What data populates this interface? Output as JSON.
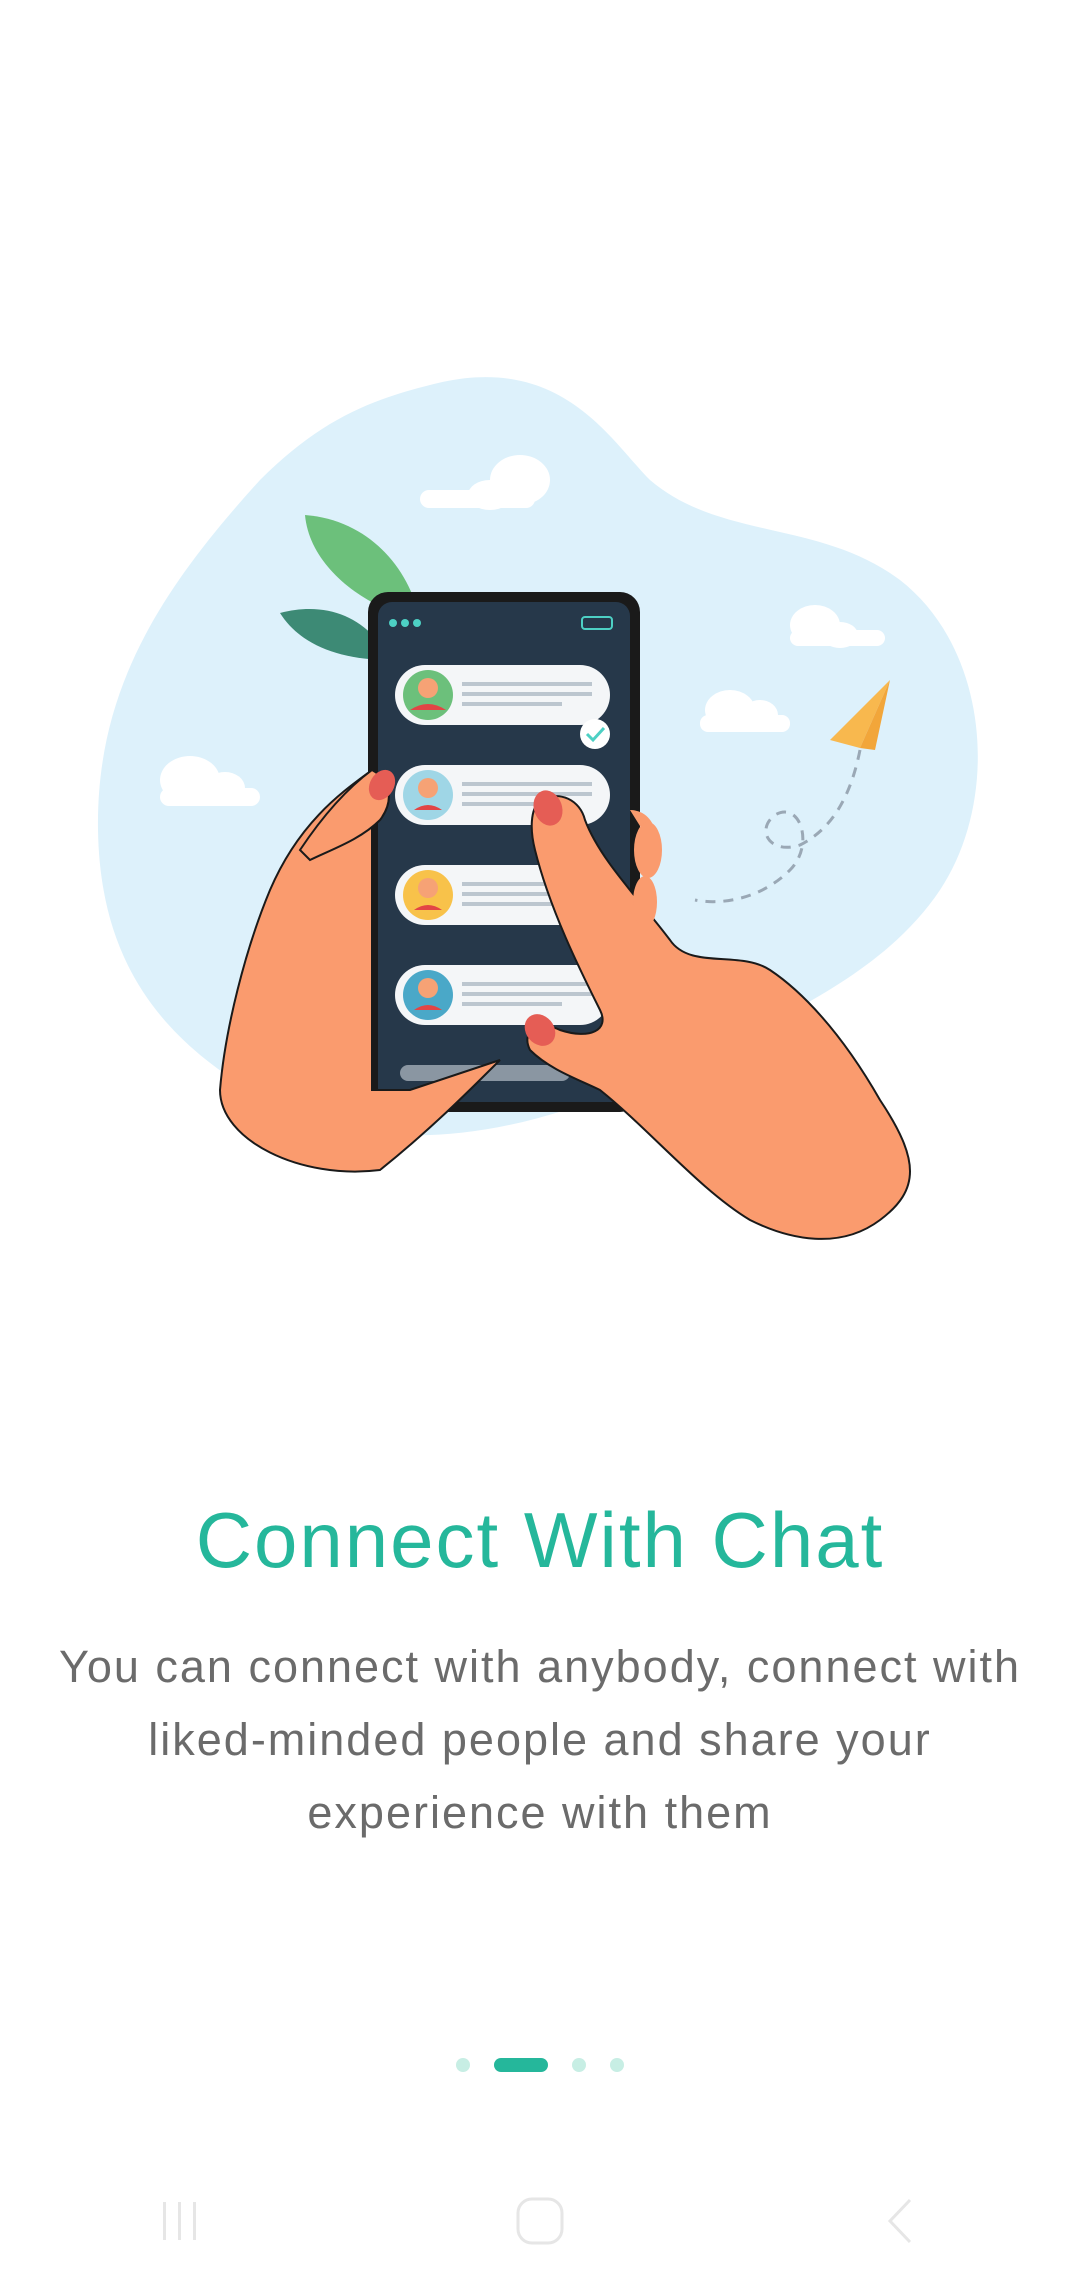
{
  "onboarding": {
    "title": "Connect With Chat",
    "description": "You can connect with anybody, connect with liked-minded people and share your experience with them",
    "page_indicator": {
      "total": 4,
      "current": 2
    }
  },
  "colors": {
    "accent": "#25b79b",
    "dot_inactive": "#c7eee4",
    "text_secondary": "#6b6b6b",
    "blob": "#ddf1fb"
  },
  "navbar": {
    "icons": [
      "recent-apps-icon",
      "home-icon",
      "back-icon"
    ]
  }
}
